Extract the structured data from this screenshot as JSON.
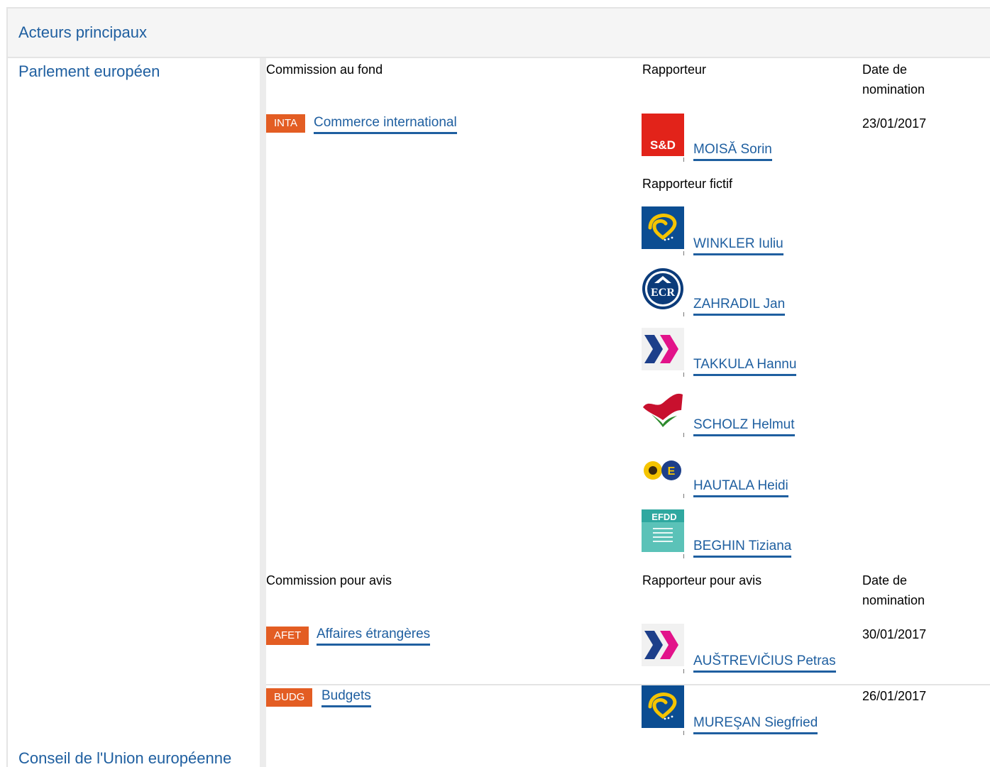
{
  "section_title": "Acteurs principaux",
  "left": {
    "ep": "Parlement européen",
    "council": "Conseil de l'Union européenne"
  },
  "lead": {
    "col_committee": "Commission au fond",
    "col_rapporteur": "Rapporteur",
    "col_date": [
      "Date de",
      "nomination"
    ],
    "committee_code": "INTA",
    "committee_name": "Commerce international",
    "rapporteur": {
      "name": "MOISĂ Sorin",
      "logo": "s-and-d-logo",
      "logo_text": "S&D"
    },
    "date": "23/01/2017",
    "shadow_label": "Rapporteur fictif",
    "shadows": [
      {
        "name": "WINKLER Iuliu",
        "logo": "epp-logo"
      },
      {
        "name": "ZAHRADIL Jan",
        "logo": "ecr-logo",
        "logo_text": "ECR"
      },
      {
        "name": "TAKKULA Hannu",
        "logo": "alde-logo"
      },
      {
        "name": "SCHOLZ Helmut",
        "logo": "gue-ngl-logo"
      },
      {
        "name": "HAUTALA Heidi",
        "logo": "greens-efa-logo"
      },
      {
        "name": "BEGHIN Tiziana",
        "logo": "efdd-logo",
        "logo_text": "EFDD"
      }
    ]
  },
  "opinion": {
    "col_committee": "Commission pour avis",
    "col_rapporteur": "Rapporteur pour avis",
    "col_date": [
      "Date de",
      "nomination"
    ],
    "rows": [
      {
        "code": "AFET",
        "name": "Affaires étrangères",
        "rapporteur": "AUŠTREVIČIUS Petras",
        "logo": "alde-logo",
        "date": "30/01/2017"
      },
      {
        "code": "BUDG",
        "name": "Budgets",
        "rapporteur": "MUREŞAN Siegfried",
        "logo": "epp-logo",
        "date": "26/01/2017"
      }
    ]
  },
  "colors": {
    "link": "#1f5fa0",
    "badge": "#e35d23",
    "header_bg": "#f5f5f5",
    "divider": "#e4e4e4"
  }
}
